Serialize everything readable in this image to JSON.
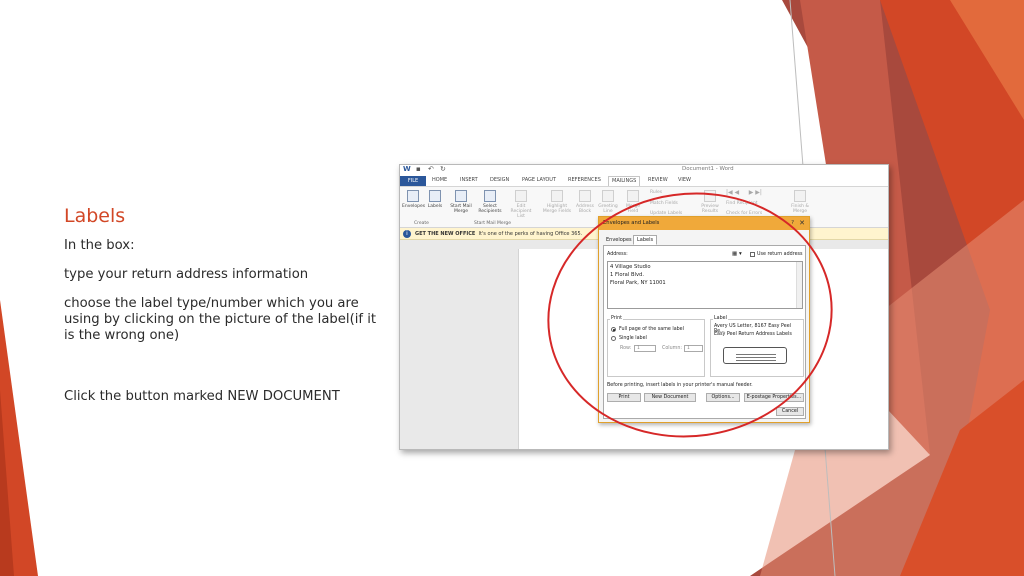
{
  "slide": {
    "title": "Labels",
    "bullets": [
      "In the box:",
      "type your return address information",
      "choose the label type/number which you are using by clicking on the picture of the label(if it is the wrong one)",
      "Click the button marked NEW DOCUMENT"
    ],
    "colors": {
      "accent": "#d24726",
      "text": "#2b2b2b",
      "highlight_circle": "#d62828"
    }
  },
  "word": {
    "window_title": "Document1 - Word",
    "tabs": [
      "FILE",
      "HOME",
      "INSERT",
      "DESIGN",
      "PAGE LAYOUT",
      "REFERENCES",
      "MAILINGS",
      "REVIEW",
      "VIEW"
    ],
    "active_tab": "MAILINGS",
    "ribbon": {
      "envelopes": "Envelopes",
      "labels": "Labels",
      "start_mail_merge": "Start Mail Merge",
      "select_recipients": "Select Recipients",
      "edit_recipient_list": "Edit Recipient List",
      "highlight_merge_fields": "Highlight Merge Fields",
      "address_block": "Address Block",
      "greeting_line": "Greeting Line",
      "insert_merge_field": "Merge Field",
      "rules": "Rules",
      "match_fields": "Match Fields",
      "update_labels": "Update Labels",
      "preview_results": "Preview Results",
      "find_recipient": "Find Recipient",
      "check_for_errors": "Check for Errors",
      "finish_merge": "Finish & Merge",
      "group_create": "Create",
      "group_start_mail_merge": "Start Mail Merge"
    },
    "message_bar": {
      "label": "GET THE NEW OFFICE",
      "text": "It's one of the perks of having Office 365."
    }
  },
  "dialog": {
    "title": "Envelopes and Labels",
    "help": "?",
    "close": "✕",
    "tabs": [
      "Envelopes",
      "Labels"
    ],
    "active_tab": "Labels",
    "address_label": "Address:",
    "use_return_address": "Use return address",
    "address_lines": [
      "4 Village Studio",
      "1 Floral Blvd.",
      "Floral Park, NY 11001"
    ],
    "print_group": "Print",
    "full_page": "Full page of the same label",
    "single_label": "Single label",
    "row_label": "Row:",
    "row_value": "1",
    "column_label": "Column:",
    "column_value": "1",
    "label_group": "Label",
    "label_name": "Avery US Letter, 8167 Easy Peel Re...",
    "label_desc": "Easy Peel Return Address Labels",
    "note": "Before printing, insert labels in your printer's manual feeder.",
    "buttons": {
      "print": "Print",
      "new_document": "New Document",
      "options": "Options...",
      "epostage": "E-postage Properties...",
      "cancel": "Cancel"
    }
  }
}
